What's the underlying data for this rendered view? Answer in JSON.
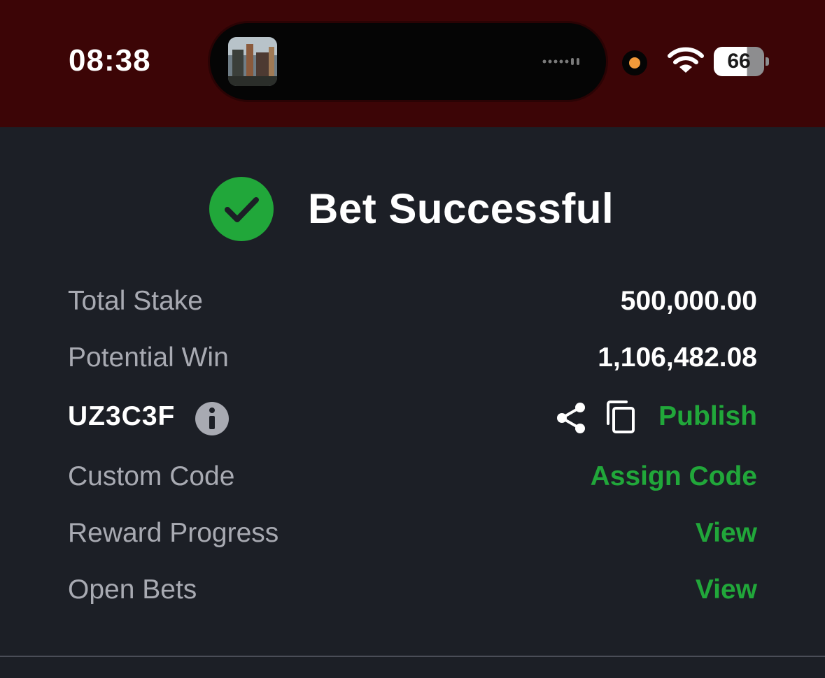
{
  "status_bar": {
    "time": "08:38",
    "battery": "66"
  },
  "bet_result": {
    "title": "Bet Successful",
    "rows": [
      {
        "label": "Total Stake",
        "value": "500,000.00"
      },
      {
        "label": "Potential Win",
        "value": "1,106,482.08"
      }
    ],
    "booking_code": "UZ3C3F",
    "publish_label": "Publish",
    "actions": [
      {
        "label": "Custom Code",
        "value": "Assign Code"
      },
      {
        "label": "Reward Progress",
        "value": "View"
      },
      {
        "label": "Open Bets",
        "value": "View"
      }
    ]
  },
  "colors": {
    "accent_green": "#21a73a",
    "status_bar_bg": "#3c0506",
    "panel_bg": "#1c1f26"
  },
  "icons": [
    "success-check-icon",
    "info-icon",
    "share-icon",
    "copy-icon",
    "wifi-icon",
    "battery-icon"
  ]
}
